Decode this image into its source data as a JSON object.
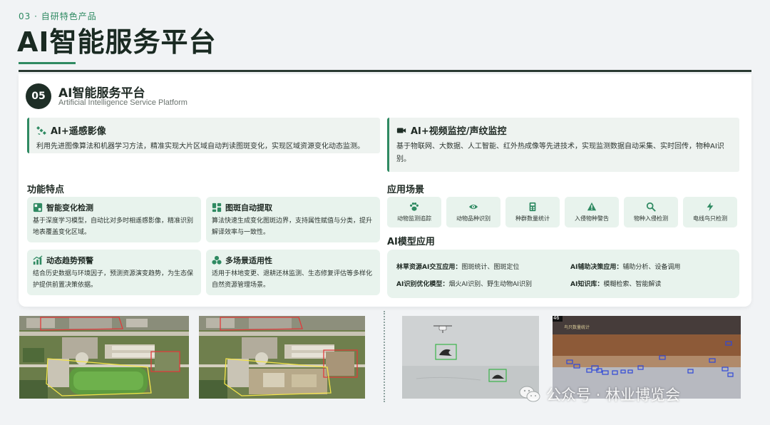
{
  "header": {
    "section_tag": "03 · 自研特色产品",
    "title": "AI智能服务平台"
  },
  "card": {
    "badge": "05",
    "title": "AI智能服务平台",
    "subtitle": "Artificial Intelligence Service Platform"
  },
  "intro": [
    {
      "icon": "satellite-icon",
      "title": "AI+遥感影像",
      "text": "利用先进图像算法和机器学习方法，精准实现大片区域自动判读图斑变化，实现区域资源变化动态监测。"
    },
    {
      "icon": "video-camera-icon",
      "title": "AI+视频监控/声纹监控",
      "text": "基于物联网、大数据、人工智能、红外热成像等先进技术，实现监测数据自动采集、实时回传，物种AI识别。"
    }
  ],
  "features": {
    "heading": "功能特点",
    "items": [
      {
        "icon": "compare-icon",
        "title": "智能变化检测",
        "text": "基于深度学习模型，自动比对多时相遥感影像，精准识别地表覆盖变化区域。"
      },
      {
        "icon": "extract-icon",
        "title": "图斑自动提取",
        "text": "算法快速生成变化图斑边界，支持属性赋值与分类，提升解译效率与一致性。"
      },
      {
        "icon": "trend-chart-icon",
        "title": "动态趋势预警",
        "text": "结合历史数据与环境因子，预测资源演变趋势，为生态保护提供前置决策依据。"
      },
      {
        "icon": "multi-scene-icon",
        "title": "多场景适用性",
        "text": "适用于林地变更、退耕还林监测、生态修复评估等多样化自然资源管理场景。"
      }
    ]
  },
  "scenes": {
    "heading": "应用场景",
    "items": [
      {
        "icon": "paw-icon",
        "label": "动物监测追踪"
      },
      {
        "icon": "eye-icon",
        "label": "动物品种识别"
      },
      {
        "icon": "calculator-icon",
        "label": "种群数量统计"
      },
      {
        "icon": "warning-icon",
        "label": "入侵物种警告"
      },
      {
        "icon": "search-icon",
        "label": "物种入侵检测"
      },
      {
        "icon": "lightning-icon",
        "label": "电线鸟只检测"
      }
    ]
  },
  "models": {
    "heading": "AI模型应用",
    "items": [
      {
        "name": "林草资源AI交互应用：",
        "desc": "图斑统计、图斑定位"
      },
      {
        "name": "AI辅助决策应用：",
        "desc": "辅助分析、设备调用"
      },
      {
        "name": "AI识别优化模型：",
        "desc": "烟火AI识别、野生动物AI识别"
      },
      {
        "name": "AI知识库：",
        "desc": "模糊检索、智能解读"
      }
    ]
  },
  "photos": {
    "thermal_counter": "46",
    "thermal_caption": "鸟只数量统计"
  },
  "watermark": "公众号 · 林业博览会",
  "colors": {
    "accent": "#2f8a62",
    "dark": "#1e2e26",
    "tile": "#e8f3ed",
    "detect_box": "#2f48d8"
  }
}
